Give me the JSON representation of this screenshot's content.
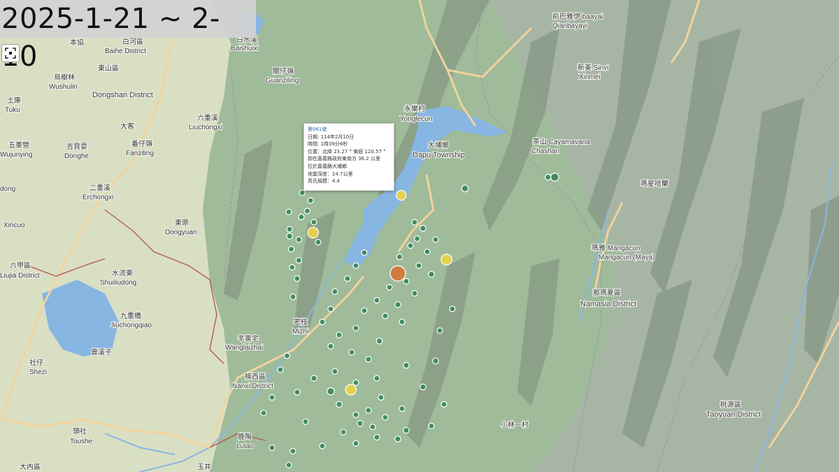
{
  "date_range": "2025-1-21 ~ 2-10",
  "popup": {
    "title": "第061號",
    "lines": [
      "日期: 114年2月10日",
      "時間: 1時39分6秒",
      "位置：北緯 23.27 ° 東經 120.57 °",
      "即在嘉義縣政府東南方 36.2 公里",
      "位於嘉義縣大埔鄉",
      "地震深度：14.7公里",
      "芮氏規模：4.4"
    ]
  },
  "place_labels": [
    {
      "id": "baishui",
      "zh": "白河區",
      "en": "Baihe District"
    },
    {
      "id": "benxie",
      "zh": "本協",
      "en": ""
    },
    {
      "id": "baishuixi",
      "zh": "白水溪",
      "en": "Baishuixi"
    },
    {
      "id": "wushulin",
      "zh": "烏樹林",
      "en": "Wushulin"
    },
    {
      "id": "dongshan",
      "zh": "東山區",
      "en": "Dongshan District"
    },
    {
      "id": "guanziling",
      "zh": "關仔嶺",
      "en": "Guanziling"
    },
    {
      "id": "tuku",
      "zh": "土庫",
      "en": "Tuku"
    },
    {
      "id": "dake",
      "zh": "大客",
      "en": ""
    },
    {
      "id": "liuchongxi",
      "zh": "六重溪",
      "en": "Liuchongxi"
    },
    {
      "id": "wujunying",
      "zh": "五軍營",
      "en": "Wujunying"
    },
    {
      "id": "donghe",
      "zh": "吉貝耍",
      "en": "Donghe"
    },
    {
      "id": "fanziling",
      "zh": "番仔嶺",
      "en": "Fanziling"
    },
    {
      "id": "dong",
      "zh": "",
      "en": "dong"
    },
    {
      "id": "erchongxi",
      "zh": "二重溪",
      "en": "Erchongxi"
    },
    {
      "id": "xincuo",
      "zh": "",
      "en": "Xincuo"
    },
    {
      "id": "dongyuan",
      "zh": "東原",
      "en": "Dongyuan"
    },
    {
      "id": "liujia",
      "zh": "六甲區",
      "en": "Liujia District"
    },
    {
      "id": "shuiliudong",
      "zh": "水流東",
      "en": "Shuiliudong"
    },
    {
      "id": "jiuchongqiao",
      "zh": "九重橋",
      "en": "Jiuchongqiao"
    },
    {
      "id": "zengwenzi",
      "zh": "曾溪子",
      "en": ""
    },
    {
      "id": "shezi",
      "zh": "社仔",
      "en": "Shezi"
    },
    {
      "id": "wanglaizhai",
      "zh": "芊萊宅",
      "en": "Wanglaizhai"
    },
    {
      "id": "milin",
      "zh": "密枝",
      "en": "Mizhi"
    },
    {
      "id": "nanxi",
      "zh": "楠西區",
      "en": "Nanxi District"
    },
    {
      "id": "toushe",
      "zh": "頭社",
      "en": "Toushe"
    },
    {
      "id": "lutao",
      "zh": "鹿陶",
      "en": "Lutao"
    },
    {
      "id": "yonglecun",
      "zh": "永樂村",
      "en": "Yonglecun"
    },
    {
      "id": "dapu",
      "zh": "大埔鄉",
      "en": "Dapu Township"
    },
    {
      "id": "qianbayayi",
      "zh": "前巴雅伊 baayai",
      "en": "Qianbayayi"
    },
    {
      "id": "xinmei",
      "zh": "新美 Sinvi",
      "en": "Xinmei"
    },
    {
      "id": "chashan",
      "zh": "茶山 Cayamavana",
      "en": "Chashan"
    },
    {
      "id": "maxinghahan",
      "zh": "瑪星哈蘭",
      "en": ""
    },
    {
      "id": "mangacun",
      "zh": "瑪雅 Mangacun",
      "en": "Mangacun (Maya)"
    },
    {
      "id": "namasia",
      "zh": "那瑪夏區",
      "en": "Namasia District"
    },
    {
      "id": "xiaolin",
      "zh": "小林一村",
      "en": ""
    },
    {
      "id": "taoyuan",
      "zh": "桃源區",
      "en": "Taoyuan District"
    },
    {
      "id": "xintian",
      "zh": "大內區",
      "en": ""
    },
    {
      "id": "yujing",
      "zh": "玉井",
      "en": ""
    }
  ],
  "colors": {
    "quake_green": "#3d8a5e",
    "quake_yellow": "#e8d34a",
    "quake_orange": "#d27a3a",
    "river": "#87b6e2",
    "road": "#f1d39e",
    "boundary": "#b55a4e"
  },
  "earthquakes": [
    {
      "lat": 23.271,
      "lon": 120.57,
      "mag": 4.4,
      "level": "orange"
    },
    {
      "lat": 23.318,
      "lon": 120.469,
      "mag": 3.4,
      "level": "yellow"
    },
    {
      "lat": 23.287,
      "lon": 120.628,
      "mag": 3.4,
      "level": "yellow"
    },
    {
      "lat": 23.137,
      "lon": 120.514,
      "mag": 3.4,
      "level": "yellow"
    },
    {
      "lat": 23.361,
      "lon": 120.574,
      "mag": 3.2,
      "level": "yellow"
    },
    {
      "lat": 23.382,
      "lon": 120.757,
      "mag": 2.8,
      "level": "green"
    },
    {
      "lat": 23.382,
      "lon": 120.749,
      "mag": 2.3,
      "level": "green"
    },
    {
      "lat": 23.369,
      "lon": 120.65,
      "mag": 2.5,
      "level": "green"
    },
    {
      "lat": 23.364,
      "lon": 120.456,
      "mag": 1.8,
      "level": "green"
    },
    {
      "lat": 23.355,
      "lon": 120.466,
      "mag": 1.8,
      "level": "green"
    },
    {
      "lat": 23.343,
      "lon": 120.462,
      "mag": 1.8,
      "level": "green"
    },
    {
      "lat": 23.342,
      "lon": 120.44,
      "mag": 1.8,
      "level": "green"
    },
    {
      "lat": 23.336,
      "lon": 120.455,
      "mag": 1.8,
      "level": "green"
    },
    {
      "lat": 23.33,
      "lon": 120.47,
      "mag": 1.8,
      "level": "green"
    },
    {
      "lat": 23.322,
      "lon": 120.441,
      "mag": 1.8,
      "level": "green"
    },
    {
      "lat": 23.31,
      "lon": 120.452,
      "mag": 1.8,
      "level": "green"
    },
    {
      "lat": 23.307,
      "lon": 120.475,
      "mag": 1.8,
      "level": "green"
    },
    {
      "lat": 23.299,
      "lon": 120.443,
      "mag": 1.8,
      "level": "green"
    },
    {
      "lat": 23.286,
      "lon": 120.452,
      "mag": 1.8,
      "level": "green"
    },
    {
      "lat": 23.278,
      "lon": 120.444,
      "mag": 1.8,
      "level": "green"
    },
    {
      "lat": 23.265,
      "lon": 120.45,
      "mag": 1.8,
      "level": "green"
    },
    {
      "lat": 23.244,
      "lon": 120.445,
      "mag": 1.8,
      "level": "green"
    },
    {
      "lat": 23.314,
      "lon": 120.441,
      "mag": 2.3,
      "level": "green"
    },
    {
      "lat": 23.33,
      "lon": 120.59,
      "mag": 1.8,
      "level": "green"
    },
    {
      "lat": 23.323,
      "lon": 120.6,
      "mag": 2.3,
      "level": "green"
    },
    {
      "lat": 23.311,
      "lon": 120.593,
      "mag": 1.8,
      "level": "green"
    },
    {
      "lat": 23.31,
      "lon": 120.615,
      "mag": 1.8,
      "level": "green"
    },
    {
      "lat": 23.303,
      "lon": 120.585,
      "mag": 1.8,
      "level": "green"
    },
    {
      "lat": 23.296,
      "lon": 120.605,
      "mag": 1.8,
      "level": "green"
    },
    {
      "lat": 23.29,
      "lon": 120.572,
      "mag": 1.8,
      "level": "green"
    },
    {
      "lat": 23.28,
      "lon": 120.595,
      "mag": 1.8,
      "level": "green"
    },
    {
      "lat": 23.27,
      "lon": 120.61,
      "mag": 2.3,
      "level": "green"
    },
    {
      "lat": 23.262,
      "lon": 120.58,
      "mag": 1.8,
      "level": "green"
    },
    {
      "lat": 23.255,
      "lon": 120.56,
      "mag": 1.8,
      "level": "green"
    },
    {
      "lat": 23.248,
      "lon": 120.59,
      "mag": 1.8,
      "level": "green"
    },
    {
      "lat": 23.24,
      "lon": 120.545,
      "mag": 1.8,
      "level": "green"
    },
    {
      "lat": 23.235,
      "lon": 120.57,
      "mag": 2.3,
      "level": "green"
    },
    {
      "lat": 23.228,
      "lon": 120.53,
      "mag": 1.8,
      "level": "green"
    },
    {
      "lat": 23.222,
      "lon": 120.555,
      "mag": 1.8,
      "level": "green"
    },
    {
      "lat": 23.215,
      "lon": 120.575,
      "mag": 1.8,
      "level": "green"
    },
    {
      "lat": 23.208,
      "lon": 120.52,
      "mag": 1.8,
      "level": "green"
    },
    {
      "lat": 23.2,
      "lon": 120.5,
      "mag": 1.8,
      "level": "green"
    },
    {
      "lat": 23.193,
      "lon": 120.548,
      "mag": 2.3,
      "level": "green"
    },
    {
      "lat": 23.187,
      "lon": 120.49,
      "mag": 1.8,
      "level": "green"
    },
    {
      "lat": 23.18,
      "lon": 120.515,
      "mag": 1.8,
      "level": "green"
    },
    {
      "lat": 23.172,
      "lon": 120.535,
      "mag": 1.8,
      "level": "green"
    },
    {
      "lat": 23.165,
      "lon": 120.58,
      "mag": 2.3,
      "level": "green"
    },
    {
      "lat": 23.158,
      "lon": 120.495,
      "mag": 1.8,
      "level": "green"
    },
    {
      "lat": 23.15,
      "lon": 120.47,
      "mag": 2.3,
      "level": "green"
    },
    {
      "lat": 23.145,
      "lon": 120.52,
      "mag": 1.8,
      "level": "green"
    },
    {
      "lat": 23.14,
      "lon": 120.6,
      "mag": 2.3,
      "level": "green"
    },
    {
      "lat": 23.134,
      "lon": 120.45,
      "mag": 1.8,
      "level": "green"
    },
    {
      "lat": 23.128,
      "lon": 120.55,
      "mag": 1.8,
      "level": "green"
    },
    {
      "lat": 23.12,
      "lon": 120.5,
      "mag": 2.3,
      "level": "green"
    },
    {
      "lat": 23.115,
      "lon": 120.575,
      "mag": 1.8,
      "level": "green"
    },
    {
      "lat": 23.108,
      "lon": 120.52,
      "mag": 1.8,
      "level": "green"
    },
    {
      "lat": 23.1,
      "lon": 120.46,
      "mag": 1.8,
      "level": "green"
    },
    {
      "lat": 23.094,
      "lon": 120.54,
      "mag": 1.8,
      "level": "green"
    },
    {
      "lat": 23.088,
      "lon": 120.505,
      "mag": 1.8,
      "level": "green"
    },
    {
      "lat": 23.08,
      "lon": 120.57,
      "mag": 2.3,
      "level": "green"
    },
    {
      "lat": 23.072,
      "lon": 120.48,
      "mag": 1.8,
      "level": "green"
    },
    {
      "lat": 23.066,
      "lon": 120.445,
      "mag": 1.8,
      "level": "green"
    },
    {
      "lat": 23.215,
      "lon": 120.48,
      "mag": 1.8,
      "level": "green"
    },
    {
      "lat": 23.23,
      "lon": 120.49,
      "mag": 1.8,
      "level": "green"
    },
    {
      "lat": 23.25,
      "lon": 120.495,
      "mag": 1.8,
      "level": "green"
    },
    {
      "lat": 23.265,
      "lon": 120.51,
      "mag": 1.8,
      "level": "green"
    },
    {
      "lat": 23.28,
      "lon": 120.52,
      "mag": 1.8,
      "level": "green"
    },
    {
      "lat": 23.295,
      "lon": 120.53,
      "mag": 1.8,
      "level": "green"
    },
    {
      "lat": 23.205,
      "lon": 120.62,
      "mag": 1.8,
      "level": "green"
    },
    {
      "lat": 23.23,
      "lon": 120.635,
      "mag": 1.8,
      "level": "green"
    },
    {
      "lat": 23.17,
      "lon": 120.615,
      "mag": 2.3,
      "level": "green"
    },
    {
      "lat": 23.12,
      "lon": 120.625,
      "mag": 1.8,
      "level": "green"
    },
    {
      "lat": 23.095,
      "lon": 120.61,
      "mag": 1.8,
      "level": "green"
    },
    {
      "lat": 23.176,
      "lon": 120.438,
      "mag": 1.8,
      "level": "green"
    },
    {
      "lat": 23.16,
      "lon": 120.43,
      "mag": 1.8,
      "level": "green"
    },
    {
      "lat": 23.128,
      "lon": 120.42,
      "mag": 1.8,
      "level": "green"
    },
    {
      "lat": 23.11,
      "lon": 120.41,
      "mag": 1.8,
      "level": "green"
    },
    {
      "lat": 23.07,
      "lon": 120.42,
      "mag": 1.8,
      "level": "green"
    },
    {
      "lat": 23.05,
      "lon": 120.44,
      "mag": 1.8,
      "level": "green"
    },
    {
      "lat": 23.135,
      "lon": 120.49,
      "mag": 2.6,
      "level": "green"
    },
    {
      "lat": 23.15,
      "lon": 120.545,
      "mag": 1.8,
      "level": "green"
    },
    {
      "lat": 23.105,
      "lon": 120.555,
      "mag": 1.8,
      "level": "green"
    },
    {
      "lat": 23.09,
      "lon": 120.58,
      "mag": 2.3,
      "level": "green"
    },
    {
      "lat": 23.075,
      "lon": 120.52,
      "mag": 1.8,
      "level": "green"
    },
    {
      "lat": 23.113,
      "lon": 120.535,
      "mag": 1.8,
      "level": "green"
    },
    {
      "lat": 23.098,
      "lon": 120.525,
      "mag": 2.3,
      "level": "green"
    },
    {
      "lat": 23.082,
      "lon": 120.545,
      "mag": 1.8,
      "level": "green"
    }
  ]
}
